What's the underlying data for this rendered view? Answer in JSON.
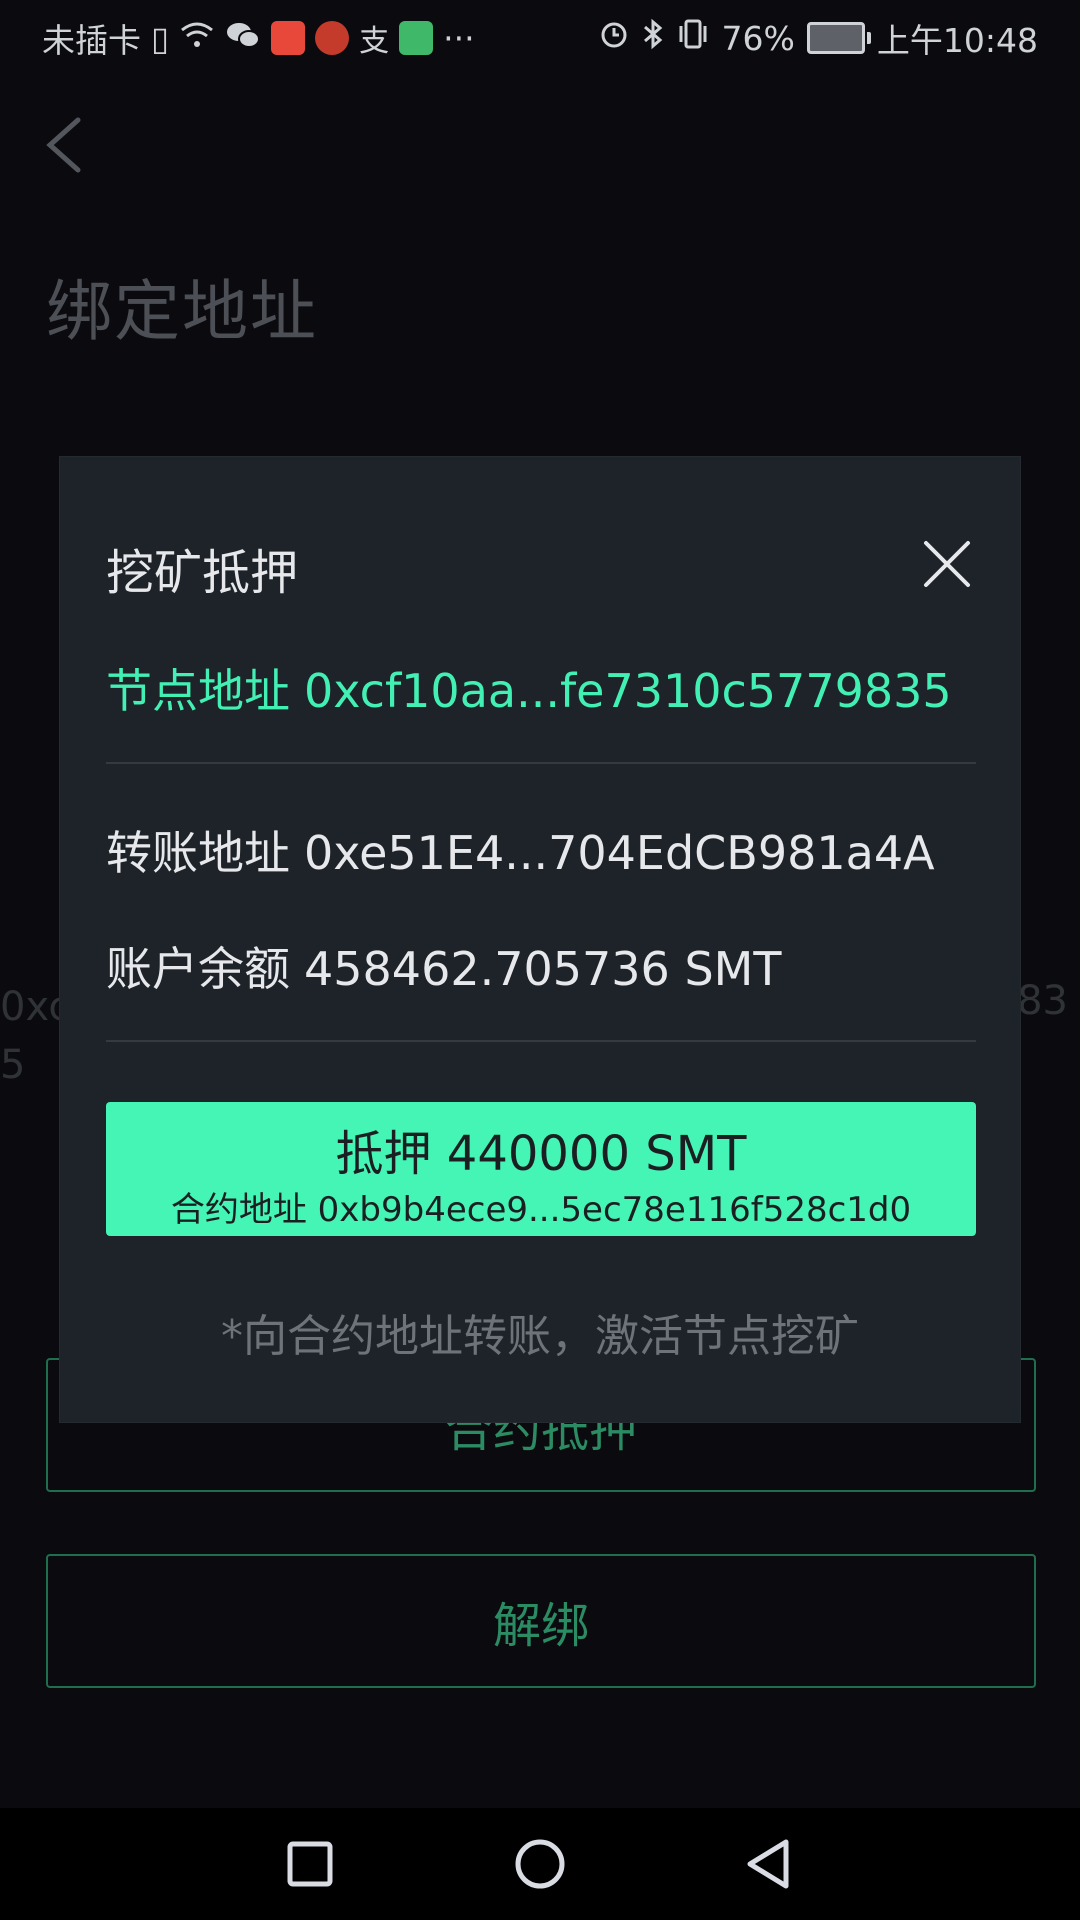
{
  "status_bar": {
    "carrier": "未插卡",
    "battery_percent": "76%",
    "time": "上午10:48"
  },
  "page": {
    "title": "绑定地址",
    "address_left": "0xc",
    "address_left_wrap": "5",
    "address_right": "83"
  },
  "buttons": {
    "contract_stake": "合约抵押",
    "unbind": "解绑"
  },
  "modal": {
    "title": "挖矿抵押",
    "node_label": "节点地址",
    "node_address": "0xcf10aa...fe7310c5779835",
    "transfer_label": "转账地址",
    "transfer_address": "0xe51E4...704EdCB981a4A",
    "balance_label": "账户余额",
    "balance_value": "458462.705736 SMT",
    "stake_button": {
      "label": "抵押 440000 SMT",
      "contract_label": "合约地址",
      "contract_address": "0xb9b4ece9...5ec78e116f528c1d0"
    },
    "hint": "*向合约地址转账，激活节点挖矿"
  },
  "colors": {
    "accent": "#44f5b6",
    "accent_text": "#43f0b4",
    "modal_bg": "#1d2328",
    "page_bg": "#0b0b0f"
  }
}
